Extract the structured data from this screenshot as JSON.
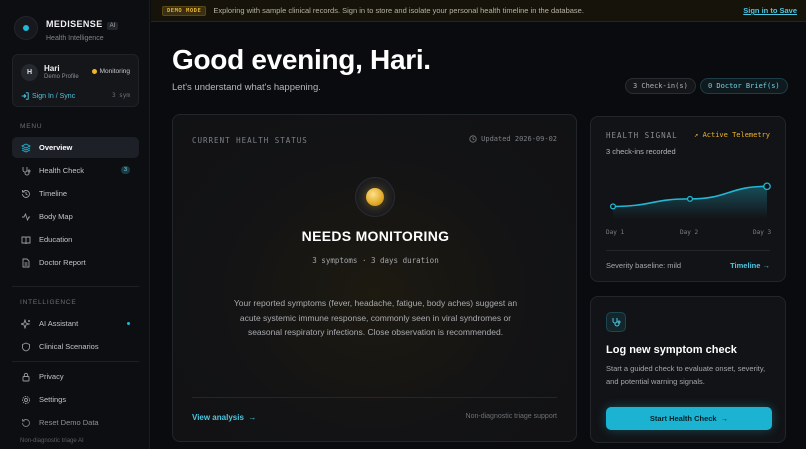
{
  "brand": {
    "name": "MEDISENSE",
    "badge": "AI",
    "subtitle": "Health Intelligence"
  },
  "profile": {
    "initial": "H",
    "name": "Hari",
    "role": "Demo Profile",
    "status": "Monitoring",
    "signin_label": "Sign In / Sync",
    "sym_count": "3 sym"
  },
  "menu": {
    "title": "MENU",
    "items": [
      {
        "label": "Overview",
        "icon": "layers-icon"
      },
      {
        "label": "Health Check",
        "icon": "stethoscope-icon",
        "badge": "3"
      },
      {
        "label": "Timeline",
        "icon": "history-icon"
      },
      {
        "label": "Body Map",
        "icon": "body-icon"
      },
      {
        "label": "Education",
        "icon": "book-icon"
      },
      {
        "label": "Doctor Report",
        "icon": "document-icon"
      }
    ]
  },
  "intelligence": {
    "title": "INTELLIGENCE",
    "items": [
      {
        "label": "AI Assistant",
        "icon": "sparkle-icon"
      },
      {
        "label": "Clinical Scenarios",
        "icon": "shield-icon"
      }
    ]
  },
  "footer_nav": [
    {
      "label": "Privacy",
      "icon": "lock-icon"
    },
    {
      "label": "Settings",
      "icon": "gear-icon"
    },
    {
      "label": "Reset Demo Data",
      "icon": "reset-icon"
    }
  ],
  "footnote": "Non-diagnostic triage AI",
  "banner": {
    "tag": "DEMO MODE",
    "text": "Exploring with sample clinical records. Sign in to store and isolate your personal health timeline in the database.",
    "link": "Sign in to Save"
  },
  "header": {
    "greeting": "Good evening, Hari.",
    "subtitle": "Let's understand what's happening.",
    "chip_checkins": "3 Check-in(s)",
    "chip_briefs": "0 Doctor Brief(s)"
  },
  "status_card": {
    "label": "CURRENT HEALTH STATUS",
    "updated": "Updated 2026-09-02",
    "title": "NEEDS MONITORING",
    "meta": "3 symptoms  ·  3 days duration",
    "description": "Your reported symptoms (fever, headache, fatigue, body aches) suggest an acute systemic immune response, commonly seen in viral syndromes or seasonal respiratory infections. Close observation is recommended.",
    "link": "View analysis",
    "note": "Non-diagnostic triage support",
    "accent": "#f0b429"
  },
  "signal_card": {
    "label": "HEALTH SIGNAL",
    "live": "Active Telemetry",
    "count": "3 check-ins recorded",
    "baseline": "Severity baseline: mild",
    "link": "Timeline",
    "chart_data": {
      "type": "area",
      "x": [
        "Day 1",
        "Day 2",
        "Day 3"
      ],
      "series": [
        {
          "values": [
            1.0,
            1.6,
            2.6
          ]
        }
      ],
      "ylim": [
        0,
        3.5
      ],
      "grid": false,
      "color": "#22b8d4"
    }
  },
  "log_card": {
    "title": "Log new symptom check",
    "description": "Start a guided check to evaluate onset, severity, and potential warning signals.",
    "button": "Start Health Check"
  }
}
